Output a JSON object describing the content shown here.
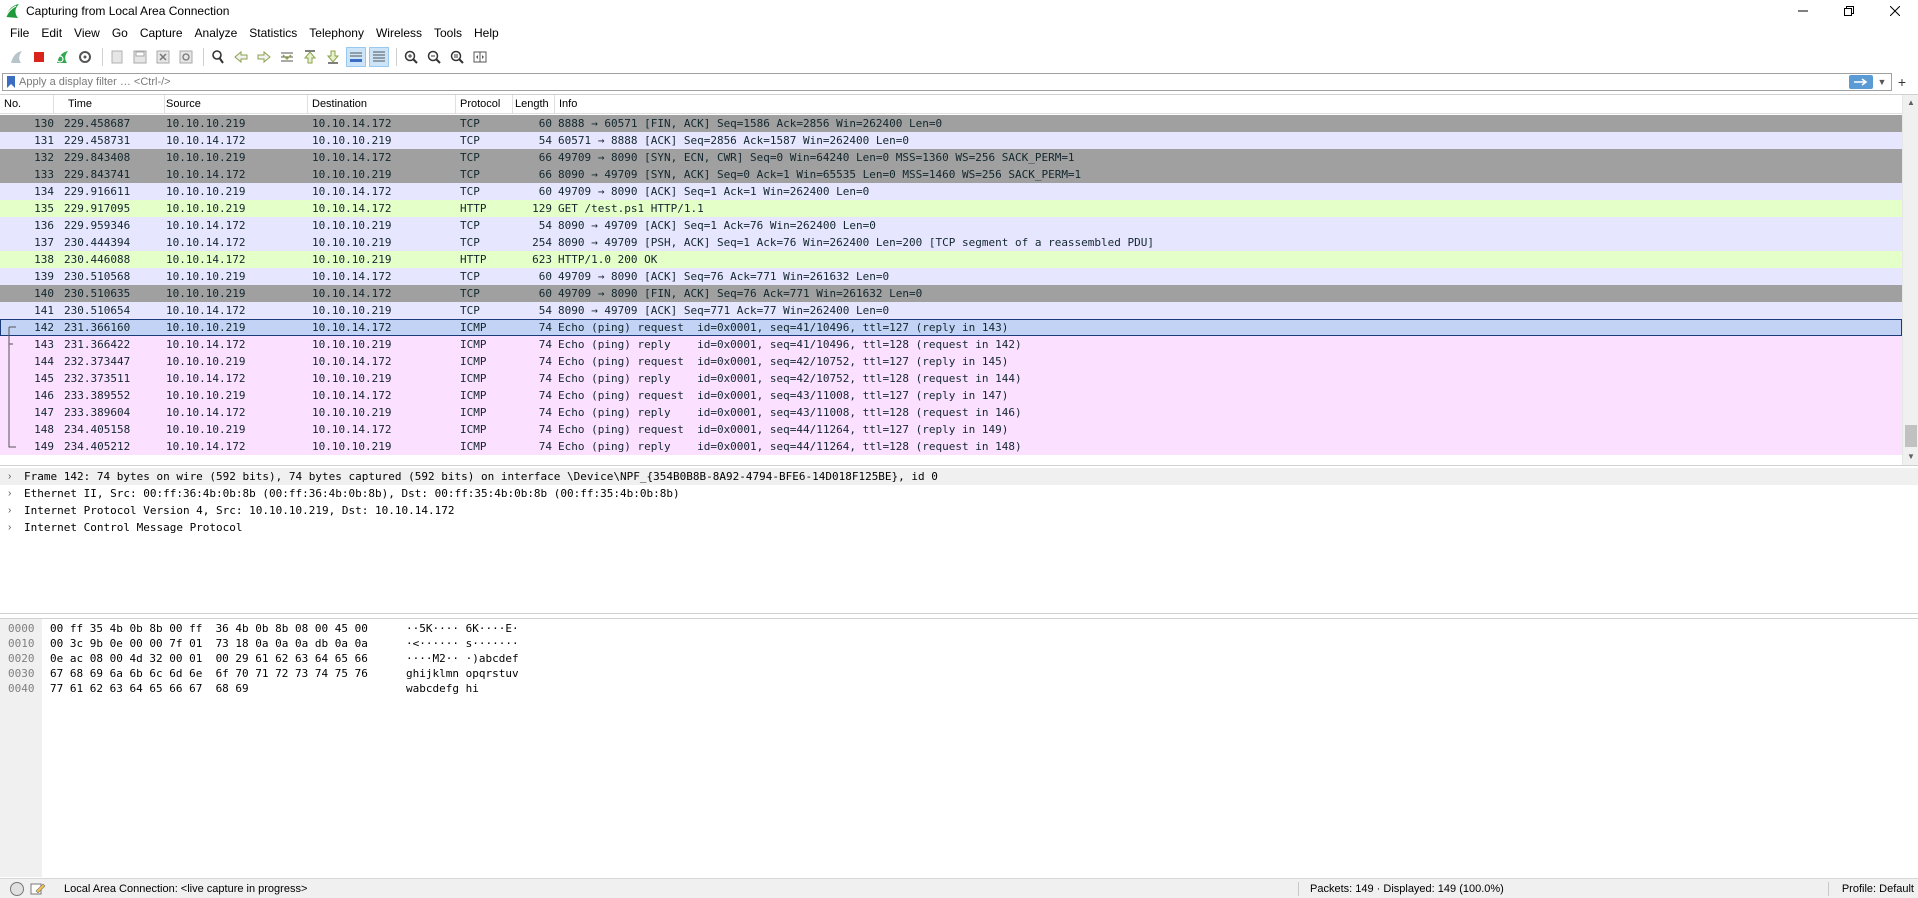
{
  "window": {
    "title": "Capturing from Local Area Connection",
    "controls": [
      "minimize",
      "restore",
      "close"
    ]
  },
  "menu": [
    "File",
    "Edit",
    "View",
    "Go",
    "Capture",
    "Analyze",
    "Statistics",
    "Telephony",
    "Wireless",
    "Tools",
    "Help"
  ],
  "toolbar": {
    "icons": [
      "start-capture-icon",
      "stop-capture-icon",
      "restart-capture-icon",
      "capture-options-icon",
      "open-file-icon",
      "save-file-icon",
      "close-file-icon",
      "reload-file-icon",
      "find-packet-icon",
      "go-back-icon",
      "go-forward-icon",
      "go-to-packet-icon",
      "go-first-icon",
      "go-last-icon",
      "autoscroll-icon",
      "colorize-icon",
      "zoom-in-icon",
      "zoom-out-icon",
      "zoom-normal-icon",
      "resize-columns-icon"
    ]
  },
  "filter": {
    "placeholder": "Apply a display filter … <Ctrl-/>",
    "value": ""
  },
  "packet_list": {
    "columns": [
      "No.",
      "Time",
      "Source",
      "Destination",
      "Protocol",
      "Length",
      "Info"
    ],
    "colors": {
      "tcp_gray": "#a0a0a0",
      "tcp": "#e7e6ff",
      "http": "#e4ffc7",
      "icmp": "#fce0ff",
      "selected": "#c3d3f5"
    },
    "rows": [
      {
        "no": "130",
        "time": "229.458687",
        "src": "10.10.10.219",
        "dst": "10.10.14.172",
        "proto": "TCP",
        "len": "60",
        "info": "8888 → 60571 [FIN, ACK] Seq=1586 Ack=2856 Win=262400 Len=0",
        "color": "tcp_gray"
      },
      {
        "no": "131",
        "time": "229.458731",
        "src": "10.10.14.172",
        "dst": "10.10.10.219",
        "proto": "TCP",
        "len": "54",
        "info": "60571 → 8888 [ACK] Seq=2856 Ack=1587 Win=262400 Len=0",
        "color": "tcp"
      },
      {
        "no": "132",
        "time": "229.843408",
        "src": "10.10.10.219",
        "dst": "10.10.14.172",
        "proto": "TCP",
        "len": "66",
        "info": "49709 → 8090 [SYN, ECN, CWR] Seq=0 Win=64240 Len=0 MSS=1360 WS=256 SACK_PERM=1",
        "color": "tcp_gray"
      },
      {
        "no": "133",
        "time": "229.843741",
        "src": "10.10.14.172",
        "dst": "10.10.10.219",
        "proto": "TCP",
        "len": "66",
        "info": "8090 → 49709 [SYN, ACK] Seq=0 Ack=1 Win=65535 Len=0 MSS=1460 WS=256 SACK_PERM=1",
        "color": "tcp_gray"
      },
      {
        "no": "134",
        "time": "229.916611",
        "src": "10.10.10.219",
        "dst": "10.10.14.172",
        "proto": "TCP",
        "len": "60",
        "info": "49709 → 8090 [ACK] Seq=1 Ack=1 Win=262400 Len=0",
        "color": "tcp"
      },
      {
        "no": "135",
        "time": "229.917095",
        "src": "10.10.10.219",
        "dst": "10.10.14.172",
        "proto": "HTTP",
        "len": "129",
        "info": "GET /test.ps1 HTTP/1.1",
        "color": "http"
      },
      {
        "no": "136",
        "time": "229.959346",
        "src": "10.10.14.172",
        "dst": "10.10.10.219",
        "proto": "TCP",
        "len": "54",
        "info": "8090 → 49709 [ACK] Seq=1 Ack=76 Win=262400 Len=0",
        "color": "tcp"
      },
      {
        "no": "137",
        "time": "230.444394",
        "src": "10.10.14.172",
        "dst": "10.10.10.219",
        "proto": "TCP",
        "len": "254",
        "info": "8090 → 49709 [PSH, ACK] Seq=1 Ack=76 Win=262400 Len=200 [TCP segment of a reassembled PDU]",
        "color": "tcp"
      },
      {
        "no": "138",
        "time": "230.446088",
        "src": "10.10.14.172",
        "dst": "10.10.10.219",
        "proto": "HTTP",
        "len": "623",
        "info": "HTTP/1.0 200 OK",
        "color": "http"
      },
      {
        "no": "139",
        "time": "230.510568",
        "src": "10.10.10.219",
        "dst": "10.10.14.172",
        "proto": "TCP",
        "len": "60",
        "info": "49709 → 8090 [ACK] Seq=76 Ack=771 Win=261632 Len=0",
        "color": "tcp"
      },
      {
        "no": "140",
        "time": "230.510635",
        "src": "10.10.10.219",
        "dst": "10.10.14.172",
        "proto": "TCP",
        "len": "60",
        "info": "49709 → 8090 [FIN, ACK] Seq=76 Ack=771 Win=261632 Len=0",
        "color": "tcp_gray"
      },
      {
        "no": "141",
        "time": "230.510654",
        "src": "10.10.14.172",
        "dst": "10.10.10.219",
        "proto": "TCP",
        "len": "54",
        "info": "8090 → 49709 [ACK] Seq=771 Ack=77 Win=262400 Len=0",
        "color": "tcp"
      },
      {
        "no": "142",
        "time": "231.366160",
        "src": "10.10.10.219",
        "dst": "10.10.14.172",
        "proto": "ICMP",
        "len": "74",
        "info": "Echo (ping) request  id=0x0001, seq=41/10496, ttl=127 (reply in 143)",
        "color": "selected",
        "selected": true
      },
      {
        "no": "143",
        "time": "231.366422",
        "src": "10.10.14.172",
        "dst": "10.10.10.219",
        "proto": "ICMP",
        "len": "74",
        "info": "Echo (ping) reply    id=0x0001, seq=41/10496, ttl=128 (request in 142)",
        "color": "icmp"
      },
      {
        "no": "144",
        "time": "232.373447",
        "src": "10.10.10.219",
        "dst": "10.10.14.172",
        "proto": "ICMP",
        "len": "74",
        "info": "Echo (ping) request  id=0x0001, seq=42/10752, ttl=127 (reply in 145)",
        "color": "icmp"
      },
      {
        "no": "145",
        "time": "232.373511",
        "src": "10.10.14.172",
        "dst": "10.10.10.219",
        "proto": "ICMP",
        "len": "74",
        "info": "Echo (ping) reply    id=0x0001, seq=42/10752, ttl=128 (request in 144)",
        "color": "icmp"
      },
      {
        "no": "146",
        "time": "233.389552",
        "src": "10.10.10.219",
        "dst": "10.10.14.172",
        "proto": "ICMP",
        "len": "74",
        "info": "Echo (ping) request  id=0x0001, seq=43/11008, ttl=127 (reply in 147)",
        "color": "icmp"
      },
      {
        "no": "147",
        "time": "233.389604",
        "src": "10.10.14.172",
        "dst": "10.10.10.219",
        "proto": "ICMP",
        "len": "74",
        "info": "Echo (ping) reply    id=0x0001, seq=43/11008, ttl=128 (request in 146)",
        "color": "icmp"
      },
      {
        "no": "148",
        "time": "234.405158",
        "src": "10.10.10.219",
        "dst": "10.10.14.172",
        "proto": "ICMP",
        "len": "74",
        "info": "Echo (ping) request  id=0x0001, seq=44/11264, ttl=127 (reply in 149)",
        "color": "icmp"
      },
      {
        "no": "149",
        "time": "234.405212",
        "src": "10.10.14.172",
        "dst": "10.10.10.219",
        "proto": "ICMP",
        "len": "74",
        "info": "Echo (ping) reply    id=0x0001, seq=44/11264, ttl=128 (request in 148)",
        "color": "icmp"
      }
    ]
  },
  "details": [
    "Frame 142: 74 bytes on wire (592 bits), 74 bytes captured (592 bits) on interface \\Device\\NPF_{354B0B8B-8A92-4794-BFE6-14D018F125BE}, id 0",
    "Ethernet II, Src: 00:ff:36:4b:0b:8b (00:ff:36:4b:0b:8b), Dst: 00:ff:35:4b:0b:8b (00:ff:35:4b:0b:8b)",
    "Internet Protocol Version 4, Src: 10.10.10.219, Dst: 10.10.14.172",
    "Internet Control Message Protocol"
  ],
  "bytes": [
    {
      "offset": "0000",
      "hex": "00 ff 35 4b 0b 8b 00 ff  36 4b 0b 8b 08 00 45 00",
      "ascii": "··5K···· 6K····E·"
    },
    {
      "offset": "0010",
      "hex": "00 3c 9b 0e 00 00 7f 01  73 18 0a 0a 0a db 0a 0a",
      "ascii": "·<······ s·······"
    },
    {
      "offset": "0020",
      "hex": "0e ac 08 00 4d 32 00 01  00 29 61 62 63 64 65 66",
      "ascii": "····M2·· ·)abcdef"
    },
    {
      "offset": "0030",
      "hex": "67 68 69 6a 6b 6c 6d 6e  6f 70 71 72 73 74 75 76",
      "ascii": "ghijklmn opqrstuv"
    },
    {
      "offset": "0040",
      "hex": "77 61 62 63 64 65 66 67  68 69",
      "ascii": "wabcdefg hi"
    }
  ],
  "status": {
    "text": "Local Area Connection: <live capture in progress>",
    "packets": "Packets: 149 · Displayed: 149 (100.0%)",
    "profile": "Profile: Default"
  }
}
